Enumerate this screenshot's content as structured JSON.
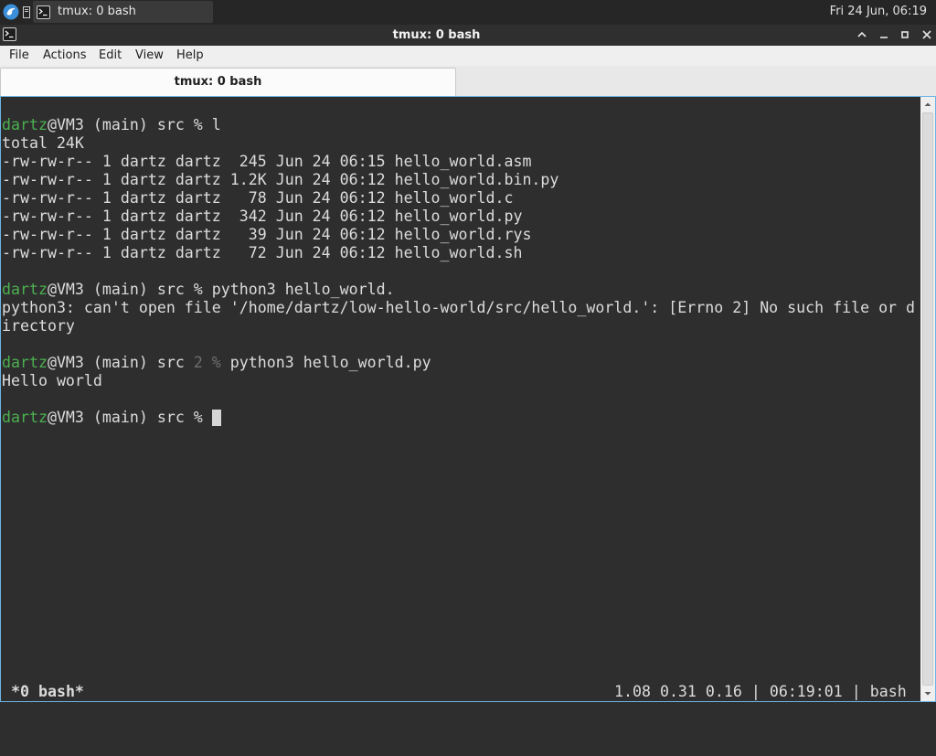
{
  "panel": {
    "app_menu_icon": "app-menu-icon",
    "show_desktop_icon": "show-desktop-icon",
    "tasks": [
      {
        "label": "tmux: 0 bash",
        "icon": "terminal-icon",
        "active": true
      }
    ],
    "clock": "Fri 24 Jun, 06:19"
  },
  "window": {
    "title": "tmux: 0 bash",
    "icon": "terminal-icon",
    "controls": [
      "shade-icon",
      "minimize-icon",
      "maximize-icon",
      "close-icon"
    ]
  },
  "menu": {
    "items": [
      "File",
      "Actions",
      "Edit",
      "View",
      "Help"
    ]
  },
  "tabs": [
    {
      "label": "tmux: 0 bash",
      "active": true
    }
  ],
  "terminal": {
    "rows": [
      {
        "segments": []
      },
      {
        "segments": [
          "dartz",
          "@VM3 (main) src % l"
        ]
      },
      {
        "segments": [
          "total 24K"
        ]
      },
      {
        "segments": [
          "-rw-rw-r-- 1 dartz dartz  245 Jun 24 06:15 hello_world.asm"
        ]
      },
      {
        "segments": [
          "-rw-rw-r-- 1 dartz dartz 1.2K Jun 24 06:12 hello_world.bin.py"
        ]
      },
      {
        "segments": [
          "-rw-rw-r-- 1 dartz dartz   78 Jun 24 06:12 hello_world.c"
        ]
      },
      {
        "segments": [
          "-rw-rw-r-- 1 dartz dartz  342 Jun 24 06:12 hello_world.py"
        ]
      },
      {
        "segments": [
          "-rw-rw-r-- 1 dartz dartz   39 Jun 24 06:12 hello_world.rys"
        ]
      },
      {
        "segments": [
          "-rw-rw-r-- 1 dartz dartz   72 Jun 24 06:12 hello_world.sh"
        ]
      },
      {
        "segments": []
      },
      {
        "segments": [
          "dartz",
          "@VM3 (main) src % python3 hello_world."
        ]
      },
      {
        "segments": [
          "python3: can't open file '/home/dartz/low-hello-world/src/hello_world.': [Errno 2] No such file or d"
        ]
      },
      {
        "segments": [
          "irectory"
        ]
      },
      {
        "segments": []
      },
      {
        "segments": [
          "dartz",
          "@VM3 (main) src ",
          "2 %",
          " python3 hello_world.py"
        ]
      },
      {
        "segments": [
          "Hello world"
        ]
      },
      {
        "segments": []
      },
      {
        "segments": [
          "dartz",
          "@VM3 (main) src % "
        ]
      }
    ],
    "status_bar": {
      "left": "*0 bash*",
      "right": "1.08 0.31 0.16 | 06:19:01 | bash"
    }
  },
  "scrollbar": {
    "icons": [
      "arrow-up-icon",
      "arrow-down-icon"
    ]
  },
  "colors": {
    "panel_background": "#262626",
    "titlebar_background": "#2f2f2f",
    "menubar_background": "#efefef",
    "terminal_background": "#2e2e2e",
    "terminal_foreground": "#dcdcdc",
    "prompt_user": "#4caf50",
    "prompt_status_dim": "#6e6e6e",
    "cursor": "#d6d6d6",
    "focus_border": "#6cb4e6",
    "app_menu_blue": "#3a8fd8"
  }
}
